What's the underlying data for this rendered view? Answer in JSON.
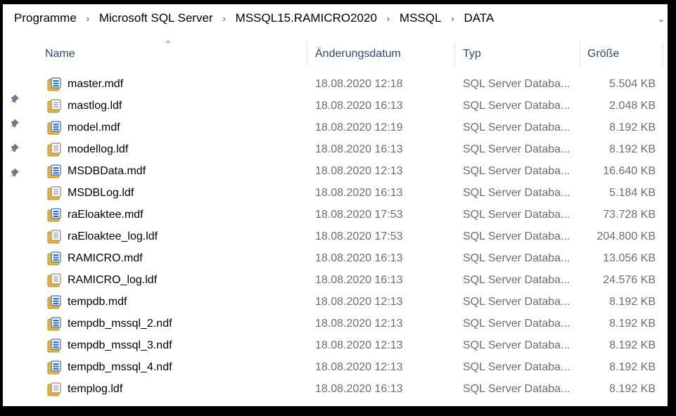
{
  "breadcrumb": {
    "items": [
      "Programme",
      "Microsoft SQL Server",
      "MSSQL15.RAMICRO2020",
      "MSSQL",
      "DATA"
    ],
    "separator": "›",
    "dropdown": "⌄"
  },
  "columns": {
    "name": "Name",
    "date": "Änderungsdatum",
    "type": "Typ",
    "size": "Größe",
    "sort_arrow": "^"
  },
  "files": [
    {
      "name": "master.mdf",
      "date": "18.08.2020 12:18",
      "type": "SQL Server Databa...",
      "size": "5.504 KB",
      "icon": "sql-data-file-icon"
    },
    {
      "name": "mastlog.ldf",
      "date": "18.08.2020 16:13",
      "type": "SQL Server Databa...",
      "size": "2.048 KB",
      "icon": "sql-log-file-icon"
    },
    {
      "name": "model.mdf",
      "date": "18.08.2020 12:19",
      "type": "SQL Server Databa...",
      "size": "8.192 KB",
      "icon": "sql-data-file-icon"
    },
    {
      "name": "modellog.ldf",
      "date": "18.08.2020 16:13",
      "type": "SQL Server Databa...",
      "size": "8.192 KB",
      "icon": "sql-log-file-icon"
    },
    {
      "name": "MSDBData.mdf",
      "date": "18.08.2020 12:13",
      "type": "SQL Server Databa...",
      "size": "16.640 KB",
      "icon": "sql-data-file-icon"
    },
    {
      "name": "MSDBLog.ldf",
      "date": "18.08.2020 16:13",
      "type": "SQL Server Databa...",
      "size": "5.184 KB",
      "icon": "sql-log-file-icon"
    },
    {
      "name": "raEloaktee.mdf",
      "date": "18.08.2020 17:53",
      "type": "SQL Server Databa...",
      "size": "73.728 KB",
      "icon": "sql-data-file-icon"
    },
    {
      "name": "raEloaktee_log.ldf",
      "date": "18.08.2020 17:53",
      "type": "SQL Server Databa...",
      "size": "204.800 KB",
      "icon": "sql-log-file-icon"
    },
    {
      "name": "RAMICRO.mdf",
      "date": "18.08.2020 16:13",
      "type": "SQL Server Databa...",
      "size": "13.056 KB",
      "icon": "sql-data-file-icon"
    },
    {
      "name": "RAMICRO_log.ldf",
      "date": "18.08.2020 16:13",
      "type": "SQL Server Databa...",
      "size": "24.576 KB",
      "icon": "sql-log-file-icon"
    },
    {
      "name": "tempdb.mdf",
      "date": "18.08.2020 12:13",
      "type": "SQL Server Databa...",
      "size": "8.192 KB",
      "icon": "sql-data-file-icon"
    },
    {
      "name": "tempdb_mssql_2.ndf",
      "date": "18.08.2020 12:13",
      "type": "SQL Server Databa...",
      "size": "8.192 KB",
      "icon": "sql-data-file-icon"
    },
    {
      "name": "tempdb_mssql_3.ndf",
      "date": "18.08.2020 12:13",
      "type": "SQL Server Databa...",
      "size": "8.192 KB",
      "icon": "sql-data-file-icon"
    },
    {
      "name": "tempdb_mssql_4.ndf",
      "date": "18.08.2020 12:13",
      "type": "SQL Server Databa...",
      "size": "8.192 KB",
      "icon": "sql-data-file-icon"
    },
    {
      "name": "templog.ldf",
      "date": "18.08.2020 16:13",
      "type": "SQL Server Databa...",
      "size": "8.192 KB",
      "icon": "sql-log-file-icon"
    }
  ],
  "colors": {
    "header_text": "#2c4a74",
    "secondary_text": "#6d6d6d",
    "icon_yellow": "#e8b53a",
    "icon_blue": "#2f6fc9"
  }
}
